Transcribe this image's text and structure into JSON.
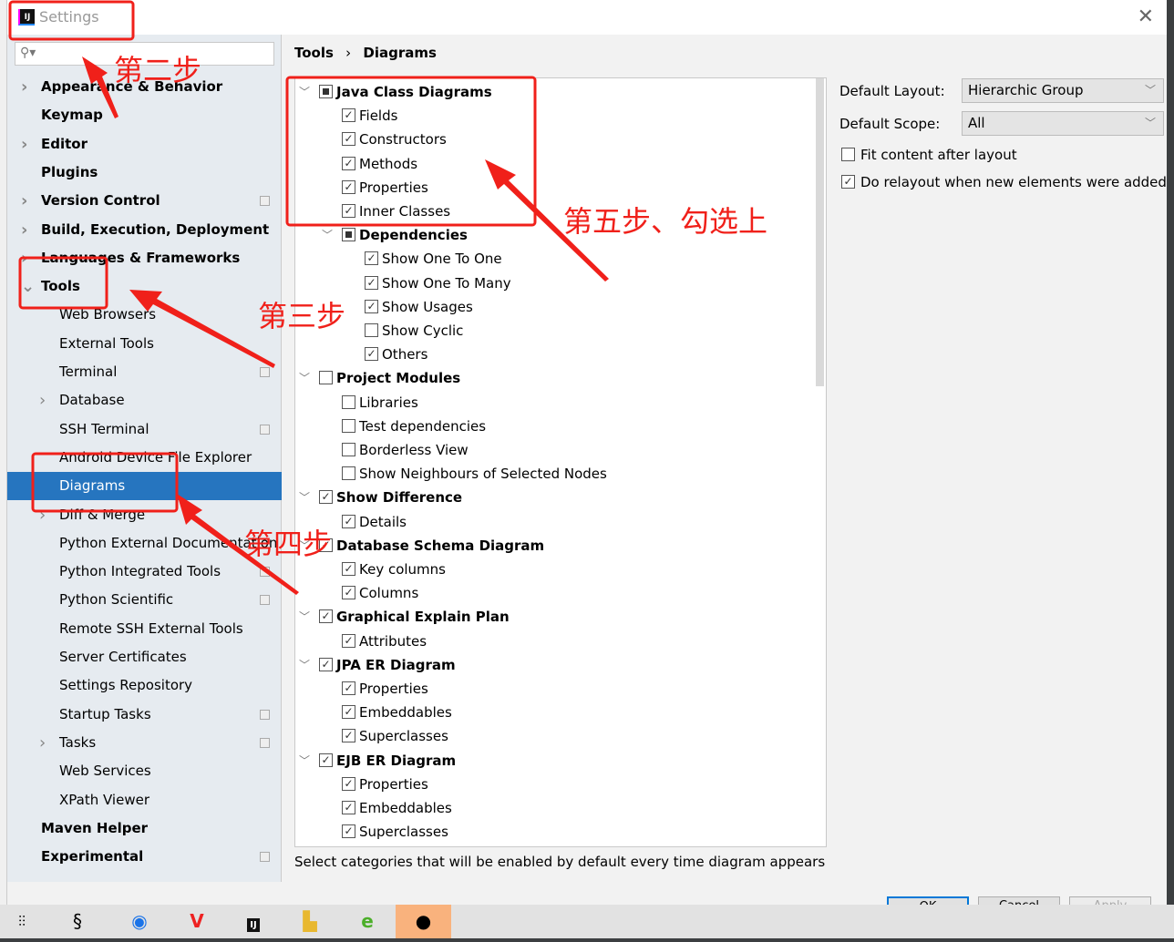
{
  "window": {
    "title": "Settings",
    "close_icon": "close-icon"
  },
  "search": {
    "placeholder": "",
    "value": ""
  },
  "sidebar": {
    "items": [
      {
        "label": "Appearance & Behavior",
        "level": 0,
        "bold": true,
        "arrow": "right",
        "icon": false
      },
      {
        "label": "Keymap",
        "level": 0,
        "bold": true,
        "arrow": null,
        "icon": false
      },
      {
        "label": "Editor",
        "level": 0,
        "bold": true,
        "arrow": "right",
        "icon": false
      },
      {
        "label": "Plugins",
        "level": 0,
        "bold": true,
        "arrow": null,
        "icon": false
      },
      {
        "label": "Version Control",
        "level": 0,
        "bold": true,
        "arrow": "right",
        "icon": true
      },
      {
        "label": "Build, Execution, Deployment",
        "level": 0,
        "bold": true,
        "arrow": "right",
        "icon": false
      },
      {
        "label": "Languages & Frameworks",
        "level": 0,
        "bold": true,
        "arrow": "right",
        "icon": false
      },
      {
        "label": "Tools",
        "level": 0,
        "bold": true,
        "arrow": "down",
        "icon": false
      },
      {
        "label": "Web Browsers",
        "level": 1,
        "bold": false,
        "arrow": null,
        "icon": false
      },
      {
        "label": "External Tools",
        "level": 1,
        "bold": false,
        "arrow": null,
        "icon": false
      },
      {
        "label": "Terminal",
        "level": 1,
        "bold": false,
        "arrow": null,
        "icon": true
      },
      {
        "label": "Database",
        "level": 1,
        "bold": false,
        "arrow": "right",
        "icon": false
      },
      {
        "label": "SSH Terminal",
        "level": 1,
        "bold": false,
        "arrow": null,
        "icon": true
      },
      {
        "label": "Android Device File Explorer",
        "level": 1,
        "bold": false,
        "arrow": null,
        "icon": false
      },
      {
        "label": "Diagrams",
        "level": 1,
        "bold": false,
        "arrow": null,
        "icon": false,
        "selected": true
      },
      {
        "label": "Diff & Merge",
        "level": 1,
        "bold": false,
        "arrow": "right",
        "icon": false
      },
      {
        "label": "Python External Documentation",
        "level": 1,
        "bold": false,
        "arrow": null,
        "icon": false
      },
      {
        "label": "Python Integrated Tools",
        "level": 1,
        "bold": false,
        "arrow": null,
        "icon": true
      },
      {
        "label": "Python Scientific",
        "level": 1,
        "bold": false,
        "arrow": null,
        "icon": true
      },
      {
        "label": "Remote SSH External Tools",
        "level": 1,
        "bold": false,
        "arrow": null,
        "icon": false
      },
      {
        "label": "Server Certificates",
        "level": 1,
        "bold": false,
        "arrow": null,
        "icon": false
      },
      {
        "label": "Settings Repository",
        "level": 1,
        "bold": false,
        "arrow": null,
        "icon": false
      },
      {
        "label": "Startup Tasks",
        "level": 1,
        "bold": false,
        "arrow": null,
        "icon": true
      },
      {
        "label": "Tasks",
        "level": 1,
        "bold": false,
        "arrow": "right",
        "icon": true
      },
      {
        "label": "Web Services",
        "level": 1,
        "bold": false,
        "arrow": null,
        "icon": false
      },
      {
        "label": "XPath Viewer",
        "level": 1,
        "bold": false,
        "arrow": null,
        "icon": false
      },
      {
        "label": "Maven Helper",
        "level": 0,
        "bold": true,
        "arrow": null,
        "icon": false
      },
      {
        "label": "Experimental",
        "level": 0,
        "bold": true,
        "arrow": null,
        "icon": true
      }
    ]
  },
  "breadcrumb": {
    "parent": "Tools",
    "separator": "›",
    "current": "Diagrams"
  },
  "tree": {
    "rows": [
      {
        "label": "Java Class Diagrams",
        "level": 0,
        "state": "partial",
        "expandable": true,
        "bold": true
      },
      {
        "label": "Fields",
        "level": 1,
        "state": "checked"
      },
      {
        "label": "Constructors",
        "level": 1,
        "state": "checked"
      },
      {
        "label": "Methods",
        "level": 1,
        "state": "checked"
      },
      {
        "label": "Properties",
        "level": 1,
        "state": "checked"
      },
      {
        "label": "Inner Classes",
        "level": 1,
        "state": "checked"
      },
      {
        "label": "Dependencies",
        "level": 1,
        "state": "partial",
        "expandable": true,
        "bold": true
      },
      {
        "label": "Show One To One",
        "level": 2,
        "state": "checked"
      },
      {
        "label": "Show One To Many",
        "level": 2,
        "state": "checked"
      },
      {
        "label": "Show Usages",
        "level": 2,
        "state": "checked"
      },
      {
        "label": "Show Cyclic",
        "level": 2,
        "state": "unchecked"
      },
      {
        "label": "Others",
        "level": 2,
        "state": "checked"
      },
      {
        "label": "Project Modules",
        "level": 0,
        "state": "unchecked",
        "expandable": true,
        "bold": true
      },
      {
        "label": "Libraries",
        "level": 1,
        "state": "unchecked"
      },
      {
        "label": "Test dependencies",
        "level": 1,
        "state": "unchecked"
      },
      {
        "label": "Borderless View",
        "level": 1,
        "state": "unchecked"
      },
      {
        "label": "Show Neighbours of Selected Nodes",
        "level": 1,
        "state": "unchecked"
      },
      {
        "label": "Show Difference",
        "level": 0,
        "state": "checked",
        "expandable": true,
        "bold": true
      },
      {
        "label": "Details",
        "level": 1,
        "state": "checked"
      },
      {
        "label": "Database Schema Diagram",
        "level": 0,
        "state": "checked",
        "expandable": true,
        "bold": true
      },
      {
        "label": "Key columns",
        "level": 1,
        "state": "checked"
      },
      {
        "label": "Columns",
        "level": 1,
        "state": "checked"
      },
      {
        "label": "Graphical Explain Plan",
        "level": 0,
        "state": "checked",
        "expandable": true,
        "bold": true
      },
      {
        "label": "Attributes",
        "level": 1,
        "state": "checked"
      },
      {
        "label": "JPA ER Diagram",
        "level": 0,
        "state": "checked",
        "expandable": true,
        "bold": true
      },
      {
        "label": "Properties",
        "level": 1,
        "state": "checked"
      },
      {
        "label": "Embeddables",
        "level": 1,
        "state": "checked"
      },
      {
        "label": "Superclasses",
        "level": 1,
        "state": "checked"
      },
      {
        "label": "EJB ER Diagram",
        "level": 0,
        "state": "checked",
        "expandable": true,
        "bold": true
      },
      {
        "label": "Properties",
        "level": 1,
        "state": "checked"
      },
      {
        "label": "Embeddables",
        "level": 1,
        "state": "checked"
      },
      {
        "label": "Superclasses",
        "level": 1,
        "state": "checked"
      }
    ]
  },
  "hint": "Select categories that will be enabled by default every time diagram appears",
  "options": {
    "layout_label": "Default Layout:",
    "layout_value": "Hierarchic Group",
    "scope_label": "Default Scope:",
    "scope_value": "All",
    "fit_label": "Fit content after layout",
    "fit_checked": false,
    "relayout_label": "Do relayout when new elements were added",
    "relayout_checked": true
  },
  "buttons": {
    "ok": "OK",
    "cancel": "Cancel",
    "apply": "Apply"
  },
  "annotations": {
    "step2": "第二步",
    "step3": "第三步",
    "step4": "第四步",
    "step5": "第五步、勾选上",
    "color": "#f0201a"
  },
  "taskbar": {
    "icons": [
      "task-view-icon",
      "app-icon",
      "chrome-icon",
      "wps-icon",
      "intellij-icon",
      "file-explorer-icon",
      "ie-icon",
      "photo-icon"
    ]
  }
}
